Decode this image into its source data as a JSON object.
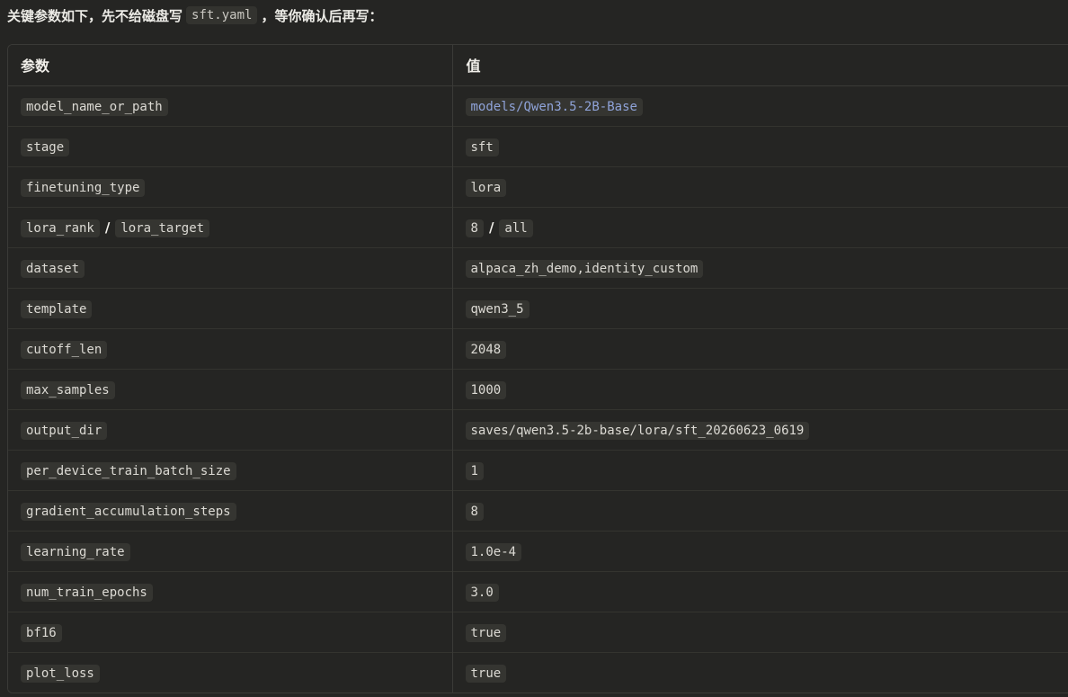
{
  "intro": {
    "before": "关键参数如下，先不给磁盘写",
    "file": "sft.yaml",
    "after": "，等你确认后再写："
  },
  "table": {
    "headers": [
      "参数",
      "值"
    ],
    "rows": [
      {
        "keys": [
          "model_name_or_path"
        ],
        "values": [
          "models/Qwen3.5-2B-Base"
        ],
        "link": true
      },
      {
        "keys": [
          "stage"
        ],
        "values": [
          "sft"
        ]
      },
      {
        "keys": [
          "finetuning_type"
        ],
        "values": [
          "lora"
        ]
      },
      {
        "keys": [
          "lora_rank",
          "lora_target"
        ],
        "values": [
          "8",
          "all"
        ]
      },
      {
        "keys": [
          "dataset"
        ],
        "values": [
          "alpaca_zh_demo,identity_custom"
        ]
      },
      {
        "keys": [
          "template"
        ],
        "values": [
          "qwen3_5"
        ]
      },
      {
        "keys": [
          "cutoff_len"
        ],
        "values": [
          "2048"
        ]
      },
      {
        "keys": [
          "max_samples"
        ],
        "values": [
          "1000"
        ]
      },
      {
        "keys": [
          "output_dir"
        ],
        "values": [
          "saves/qwen3.5-2b-base/lora/sft_20260623_0619"
        ]
      },
      {
        "keys": [
          "per_device_train_batch_size"
        ],
        "values": [
          "1"
        ]
      },
      {
        "keys": [
          "gradient_accumulation_steps"
        ],
        "values": [
          "8"
        ]
      },
      {
        "keys": [
          "learning_rate"
        ],
        "values": [
          "1.0e-4"
        ]
      },
      {
        "keys": [
          "num_train_epochs"
        ],
        "values": [
          "3.0"
        ]
      },
      {
        "keys": [
          "bf16"
        ],
        "values": [
          "true"
        ]
      },
      {
        "keys": [
          "plot_loss"
        ],
        "values": [
          "true"
        ]
      }
    ],
    "separator": "/"
  }
}
